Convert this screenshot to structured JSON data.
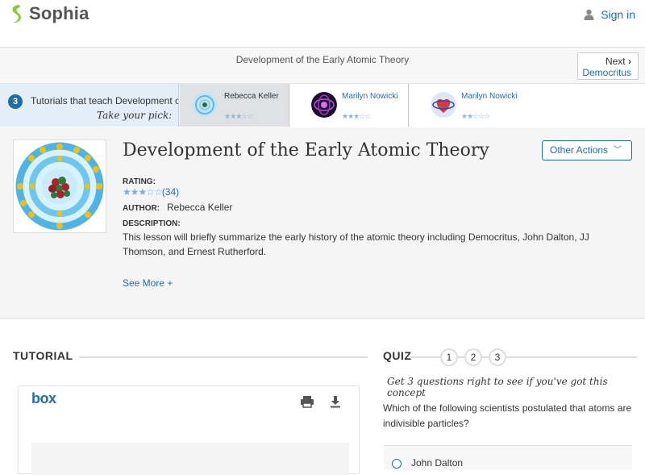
{
  "brand": {
    "name": "Sophia"
  },
  "header": {
    "signin_label": "Sign in"
  },
  "titlebar": {
    "title": "Development of the Early Atomic Theory",
    "next_label": "Next",
    "next_target": "Democritus"
  },
  "tutorials_bar": {
    "count": "3",
    "label": "Tutorials that teach Development of the Early Atomic Theory",
    "take_pick": "Take your pick:",
    "items": [
      {
        "author": "Rebecca Keller",
        "rating_stars": 3,
        "icon": "atom-icon"
      },
      {
        "author": "Marilyn Nowicki",
        "rating_stars": 3,
        "icon": "atom-purple-icon"
      },
      {
        "author": "Marilyn Nowicki",
        "rating_stars": 2,
        "icon": "atom-heart-icon"
      }
    ]
  },
  "lesson": {
    "title": "Development of the Early Atomic Theory",
    "other_actions_label": "Other Actions",
    "rating_label": "RATING:",
    "rating_stars": 3,
    "rating_count": "(34)",
    "author_label": "AUTHOR:",
    "author": "Rebecca Keller",
    "description_label": "DESCRIPTION:",
    "description": "This lesson will briefly summarize the early history of the atomic theory including Democritus, John Dalton, JJ Thomson, and Ernest Rutherford.",
    "see_more_label": "See More +"
  },
  "tutorial_section": {
    "heading": "TUTORIAL",
    "viewer_brand": "box"
  },
  "quiz": {
    "heading": "QUIZ",
    "steps": [
      "1",
      "2",
      "3"
    ],
    "instruction": "Get 3 questions right to see if you've got this concept",
    "question": "Which of the following scientists postulated that atoms are indivisible particles?",
    "first_answer": "John Dalton"
  },
  "colors": {
    "accent": "#1f6ea8",
    "brand_green": "#8cc63f"
  }
}
